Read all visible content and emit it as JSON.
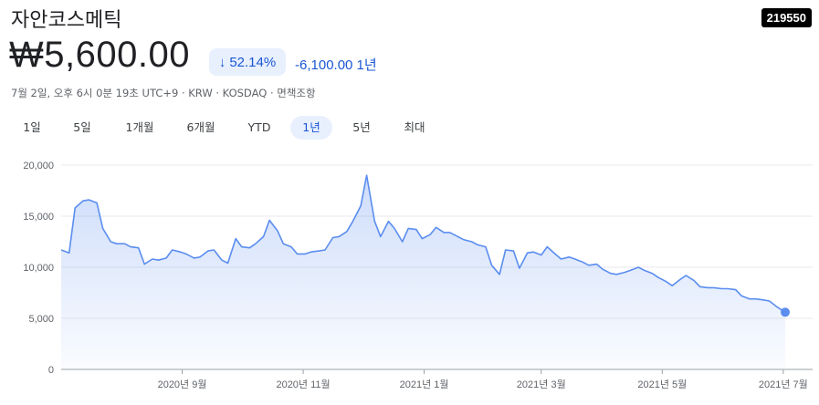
{
  "header": {
    "title": "자안코스메틱",
    "ticker": "219550",
    "price": "₩5,600.00",
    "change_pct": "52.14%",
    "change_arrow": "↓",
    "change_abs": "-6,100.00 1년",
    "meta": "7월 2일, 오후 6시 0분 19초 UTC+9 · KRW · KOSDAQ · 면책조항"
  },
  "ranges": [
    "1일",
    "5일",
    "1개월",
    "6개월",
    "YTD",
    "1년",
    "5년",
    "최대"
  ],
  "active_range": "1년",
  "colors": {
    "line": "#5b8def",
    "accent": "#1a56d6",
    "pill": "#e8f0fe"
  },
  "chart_data": {
    "type": "area",
    "title": "",
    "xlabel": "",
    "ylabel": "",
    "ylim": [
      0,
      20000
    ],
    "yticks": [
      0,
      5000,
      10000,
      15000,
      20000
    ],
    "ytick_labels": [
      "0",
      "5,000",
      "10,000",
      "15,000",
      "20,000"
    ],
    "xticks": [
      "2020-09-01",
      "2020-11-01",
      "2021-01-01",
      "2021-03-01",
      "2021-05-01",
      "2021-07-01"
    ],
    "xtick_labels": [
      "2020년 9월",
      "2020년 11월",
      "2021년 1월",
      "2021년 3월",
      "2021년 5월",
      "2021년 7월"
    ],
    "x_range": [
      "2020-07-02",
      "2021-07-02"
    ],
    "grid": true,
    "series": [
      {
        "x": [
          "2020-07-02",
          "2020-07-06",
          "2020-07-09",
          "2020-07-13",
          "2020-07-16",
          "2020-07-20",
          "2020-07-23",
          "2020-07-27",
          "2020-07-30",
          "2020-08-03",
          "2020-08-06",
          "2020-08-10",
          "2020-08-13",
          "2020-08-17",
          "2020-08-20",
          "2020-08-24",
          "2020-08-27",
          "2020-08-31",
          "2020-09-03",
          "2020-09-07",
          "2020-09-10",
          "2020-09-14",
          "2020-09-17",
          "2020-09-21",
          "2020-09-24",
          "2020-09-28",
          "2020-10-01",
          "2020-10-05",
          "2020-10-08",
          "2020-10-12",
          "2020-10-15",
          "2020-10-19",
          "2020-10-22",
          "2020-10-26",
          "2020-10-29",
          "2020-11-02",
          "2020-11-05",
          "2020-11-09",
          "2020-11-12",
          "2020-11-16",
          "2020-11-19",
          "2020-11-23",
          "2020-11-26",
          "2020-11-30",
          "2020-12-03",
          "2020-12-07",
          "2020-12-10",
          "2020-12-14",
          "2020-12-17",
          "2020-12-21",
          "2020-12-24",
          "2020-12-28",
          "2020-12-31",
          "2021-01-04",
          "2021-01-07",
          "2021-01-11",
          "2021-01-14",
          "2021-01-18",
          "2021-01-21",
          "2021-01-25",
          "2021-01-28",
          "2021-02-01",
          "2021-02-04",
          "2021-02-08",
          "2021-02-11",
          "2021-02-15",
          "2021-02-18",
          "2021-02-22",
          "2021-02-25",
          "2021-03-01",
          "2021-03-04",
          "2021-03-08",
          "2021-03-11",
          "2021-03-15",
          "2021-03-18",
          "2021-03-22",
          "2021-03-25",
          "2021-03-29",
          "2021-04-01",
          "2021-04-05",
          "2021-04-08",
          "2021-04-12",
          "2021-04-15",
          "2021-04-19",
          "2021-04-22",
          "2021-04-26",
          "2021-04-29",
          "2021-05-03",
          "2021-05-06",
          "2021-05-10",
          "2021-05-13",
          "2021-05-17",
          "2021-05-20",
          "2021-05-24",
          "2021-05-27",
          "2021-05-31",
          "2021-06-03",
          "2021-06-07",
          "2021-06-10",
          "2021-06-14",
          "2021-06-17",
          "2021-06-21",
          "2021-06-24",
          "2021-06-28",
          "2021-07-02"
        ],
        "values": [
          11700,
          11400,
          15800,
          16500,
          16600,
          16300,
          13800,
          12500,
          12300,
          12300,
          12000,
          11900,
          10300,
          10800,
          10700,
          10900,
          11700,
          11500,
          11300,
          10900,
          11000,
          11600,
          11700,
          10700,
          10400,
          12800,
          12000,
          11900,
          12300,
          13000,
          14600,
          13600,
          12300,
          12000,
          11300,
          11300,
          11500,
          11600,
          11700,
          12900,
          13000,
          13500,
          14500,
          16000,
          19000,
          14500,
          13000,
          14500,
          13800,
          12500,
          13800,
          13700,
          12800,
          13200,
          13900,
          13400,
          13400,
          13000,
          12700,
          12500,
          12200,
          12000,
          10200,
          9300,
          11700,
          11600,
          9900,
          11400,
          11500,
          11200,
          12000,
          11300,
          10800,
          11000,
          10800,
          10500,
          10200,
          10300,
          9800,
          9400,
          9300,
          9500,
          9700,
          10000,
          9700,
          9400,
          9000,
          8600,
          8200,
          8800,
          9200,
          8700,
          8100,
          8000,
          8000,
          7900,
          7900,
          7800,
          7200,
          6900,
          6900,
          6800,
          6700,
          6100,
          5600
        ]
      }
    ]
  }
}
